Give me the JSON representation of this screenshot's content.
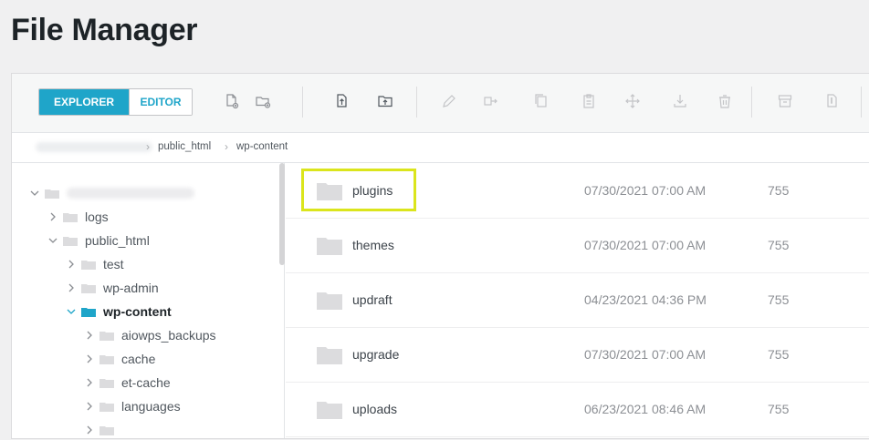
{
  "page": {
    "title": "File Manager"
  },
  "toolbar": {
    "tabs": [
      {
        "label": "EXPLORER",
        "active": true
      },
      {
        "label": "EDITOR",
        "active": false
      }
    ],
    "tools": [
      "new-file-icon",
      "new-folder-icon",
      "upload-file-icon",
      "upload-folder-icon",
      "rename-icon",
      "move-icon",
      "copy-icon",
      "paste-icon",
      "drag-icon",
      "download-icon",
      "delete-icon",
      "archive-icon",
      "extract-icon"
    ]
  },
  "breadcrumb": [
    "public_html",
    "wp-content"
  ],
  "tree": {
    "items": [
      {
        "label": "logs"
      },
      {
        "label": "public_html"
      },
      {
        "label": "test"
      },
      {
        "label": "wp-admin"
      },
      {
        "label": "wp-content"
      },
      {
        "label": "aiowps_backups"
      },
      {
        "label": "cache"
      },
      {
        "label": "et-cache"
      },
      {
        "label": "languages"
      }
    ]
  },
  "files": [
    {
      "name": "plugins",
      "date": "07/30/2021 07:00 AM",
      "perm": "755"
    },
    {
      "name": "themes",
      "date": "07/30/2021 07:00 AM",
      "perm": "755"
    },
    {
      "name": "updraft",
      "date": "04/23/2021 04:36 PM",
      "perm": "755"
    },
    {
      "name": "upgrade",
      "date": "07/30/2021 07:00 AM",
      "perm": "755"
    },
    {
      "name": "uploads",
      "date": "06/23/2021 08:46 AM",
      "perm": "755"
    }
  ],
  "colors": {
    "accent": "#1fa5c9",
    "highlight": "#dbe51c",
    "folder": "#dcdcde",
    "folder_selected": "#1fa5c9"
  }
}
